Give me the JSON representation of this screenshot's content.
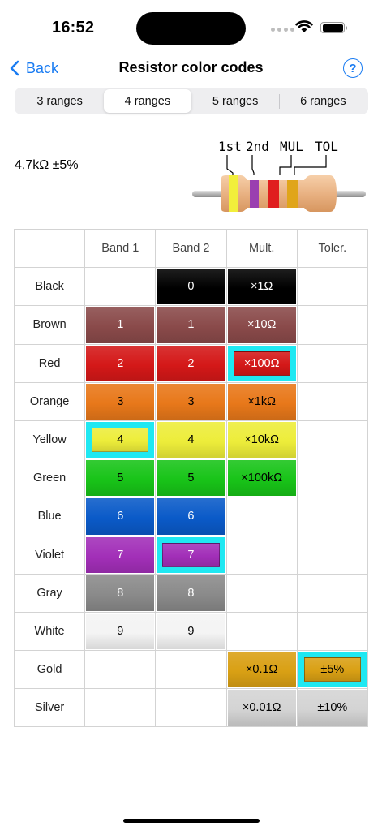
{
  "status": {
    "time": "16:52"
  },
  "nav": {
    "back_label": "Back",
    "title": "Resistor color codes",
    "help_label": "?"
  },
  "segments": [
    {
      "label": "3 ranges",
      "selected": false
    },
    {
      "label": "4 ranges",
      "selected": true
    },
    {
      "label": "5 ranges",
      "selected": false
    },
    {
      "label": "6 ranges",
      "selected": false
    }
  ],
  "resistor": {
    "value": "4,7kΩ ±5%",
    "band_labels": [
      "1st",
      "2nd",
      "MUL",
      "TOL"
    ],
    "band_colors": [
      "#f2ef3b",
      "#9a3fb0",
      "#e01e1e",
      "#e0a51a"
    ]
  },
  "table": {
    "headers": [
      "",
      "Band 1",
      "Band 2",
      "Mult.",
      "Toler."
    ],
    "rows": [
      {
        "name": "Black",
        "bg": "#000000",
        "fg": "#ffffff",
        "cells": [
          "",
          "0",
          "×1Ω",
          ""
        ]
      },
      {
        "name": "Brown",
        "bg": "#8a4a4a",
        "fg": "#ffffff",
        "cells": [
          "1",
          "1",
          "×10Ω",
          ""
        ]
      },
      {
        "name": "Red",
        "bg": "#d41818",
        "fg": "#ffffff",
        "cells": [
          "2",
          "2",
          "×100Ω",
          ""
        ]
      },
      {
        "name": "Orange",
        "bg": "#e8781a",
        "fg": "#000000",
        "cells": [
          "3",
          "3",
          "×1kΩ",
          ""
        ]
      },
      {
        "name": "Yellow",
        "bg": "#eded3a",
        "fg": "#000000",
        "cells": [
          "4",
          "4",
          "×10kΩ",
          ""
        ]
      },
      {
        "name": "Green",
        "bg": "#18c418",
        "fg": "#000000",
        "cells": [
          "5",
          "5",
          "×100kΩ",
          ""
        ]
      },
      {
        "name": "Blue",
        "bg": "#0a5ac8",
        "fg": "#ffffff",
        "cells": [
          "6",
          "6",
          "",
          ""
        ]
      },
      {
        "name": "Violet",
        "bg": "#a22fb8",
        "fg": "#ffffff",
        "cells": [
          "7",
          "7",
          "",
          ""
        ]
      },
      {
        "name": "Gray",
        "bg": "#8a8a8a",
        "fg": "#ffffff",
        "cells": [
          "8",
          "8",
          "",
          ""
        ]
      },
      {
        "name": "White",
        "bg": "#f4f4f4",
        "fg": "#000000",
        "cells": [
          "9",
          "9",
          "",
          ""
        ]
      },
      {
        "name": "Gold",
        "bg": "#d9a014",
        "fg": "#000000",
        "cells": [
          "",
          "",
          "×0.1Ω",
          "±5%"
        ]
      },
      {
        "name": "Silver",
        "bg": "#d4d4d4",
        "fg": "#000000",
        "cells": [
          "",
          "",
          "×0.01Ω",
          "±10%"
        ]
      }
    ],
    "selected": {
      "band1": "Yellow",
      "band2": "Violet",
      "mult": "Red",
      "toler": "Gold"
    }
  },
  "colors": {
    "accent": "#1a7cf2",
    "selection": "#1fe8f2"
  }
}
